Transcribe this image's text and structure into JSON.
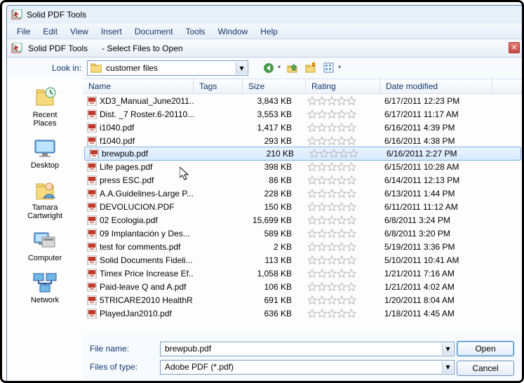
{
  "window": {
    "title": "Solid PDF Tools"
  },
  "menu": {
    "file": "File",
    "edit": "Edit",
    "view": "View",
    "insert": "Insert",
    "document": "Document",
    "tools": "Tools",
    "window": "Window",
    "help": "Help"
  },
  "dialog": {
    "title": "Solid PDF Tools      - Select Files to Open",
    "lookin_label": "Look in:",
    "lookin_value": "customer files",
    "filename_label": "File name:",
    "filename_value": "brewpub.pdf",
    "filetype_label": "Files of type:",
    "filetype_value": "Adobe PDF (*.pdf)",
    "open_button": "Open",
    "cancel_button": "Cancel"
  },
  "columns": {
    "name": "Name",
    "tags": "Tags",
    "size": "Size",
    "rating": "Rating",
    "date": "Date modified"
  },
  "places": [
    {
      "label": "Recent Places",
      "icon": "recent"
    },
    {
      "label": "Desktop",
      "icon": "desktop"
    },
    {
      "label": "Tamara Cartwright",
      "icon": "user"
    },
    {
      "label": "Computer",
      "icon": "computer"
    },
    {
      "label": "Network",
      "icon": "network"
    }
  ],
  "files": [
    {
      "name": "XD3_Manual_June2011...",
      "size": "3,843 KB",
      "date": "6/17/2011 12:23 PM",
      "selected": false
    },
    {
      "name": "Dist. _7 Roster.6-20110...",
      "size": "3,553 KB",
      "date": "6/17/2011 11:17 AM",
      "selected": false
    },
    {
      "name": "i1040.pdf",
      "size": "1,417 KB",
      "date": "6/16/2011 4:39 PM",
      "selected": false
    },
    {
      "name": "f1040.pdf",
      "size": "293 KB",
      "date": "6/16/2011 4:38 PM",
      "selected": false
    },
    {
      "name": "brewpub.pdf",
      "size": "210 KB",
      "date": "6/16/2011 2:27 PM",
      "selected": true
    },
    {
      "name": "Life pages.pdf",
      "size": "398 KB",
      "date": "6/15/2011 10:28 AM",
      "selected": false
    },
    {
      "name": "press ESC.pdf",
      "size": "86 KB",
      "date": "6/14/2011 12:13 PM",
      "selected": false
    },
    {
      "name": "A.A.Guidelines-Large P...",
      "size": "228 KB",
      "date": "6/13/2011 1:44 PM",
      "selected": false
    },
    {
      "name": "DEVOLUCION.PDF",
      "size": "150 KB",
      "date": "6/11/2011 11:12 AM",
      "selected": false
    },
    {
      "name": "02 Ecologia.pdf",
      "size": "15,699 KB",
      "date": "6/8/2011 3:24 PM",
      "selected": false
    },
    {
      "name": "09 Implantación y Des...",
      "size": "589 KB",
      "date": "6/8/2011 3:20 PM",
      "selected": false
    },
    {
      "name": "test for comments.pdf",
      "size": "2 KB",
      "date": "5/19/2011 3:36 PM",
      "selected": false
    },
    {
      "name": "Solid Documents Fideli...",
      "size": "113 KB",
      "date": "5/10/2011 10:41 AM",
      "selected": false
    },
    {
      "name": "Timex Price Increase Ef...",
      "size": "1,058 KB",
      "date": "1/21/2011 7:16 AM",
      "selected": false
    },
    {
      "name": "Paid-leave Q and A.pdf",
      "size": "106 KB",
      "date": "1/21/2011 4:02 AM",
      "selected": false
    },
    {
      "name": "5TRICARE2010 HealthR...",
      "size": "691 KB",
      "date": "1/20/2011 8:04 AM",
      "selected": false
    },
    {
      "name": "PlayedJan2010.pdf",
      "size": "636 KB",
      "date": "1/18/2011 4:45 AM",
      "selected": false
    }
  ],
  "icons": {
    "pdf": "pdf-file-icon",
    "star_empty": "star-outline-icon"
  }
}
